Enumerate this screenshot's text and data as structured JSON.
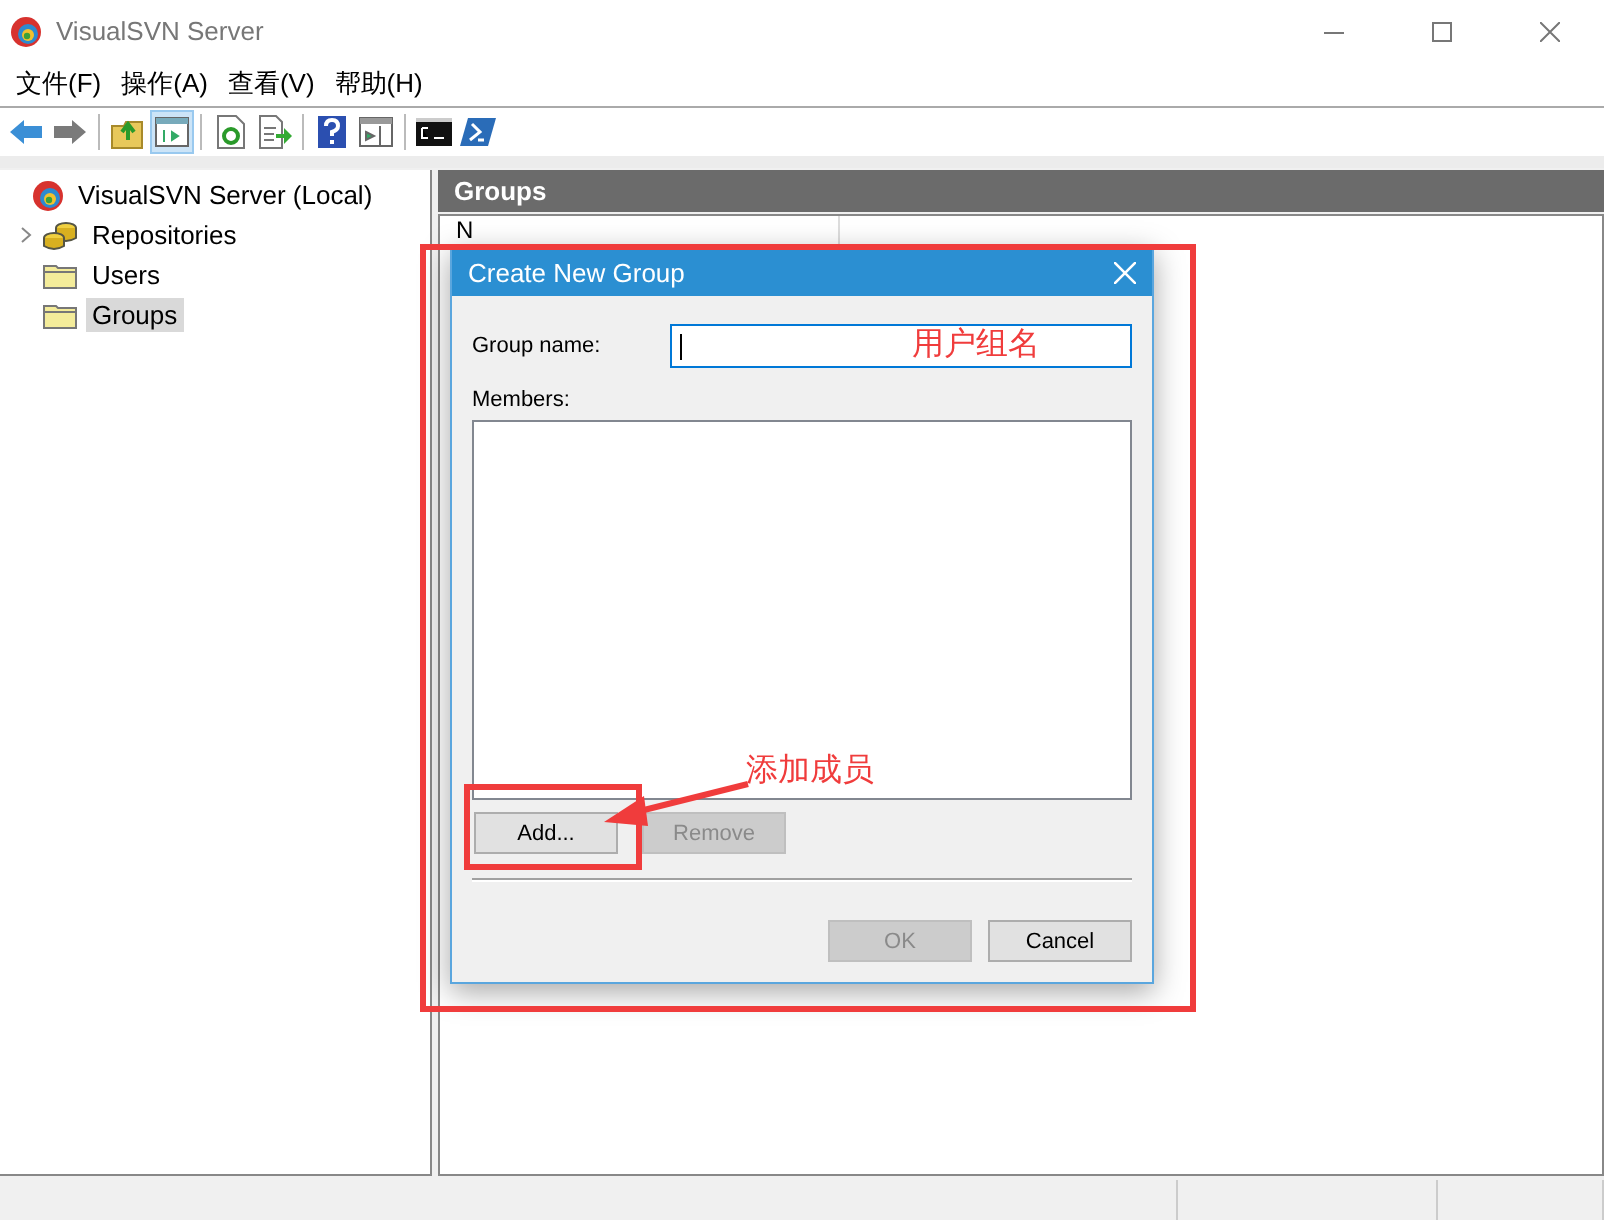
{
  "window": {
    "title": "VisualSVN Server"
  },
  "menu": [
    {
      "label": "文件(F)"
    },
    {
      "label": "操作(A)"
    },
    {
      "label": "查看(V)"
    },
    {
      "label": "帮助(H)"
    }
  ],
  "toolbar": [
    {
      "kind": "back",
      "selected": false
    },
    {
      "kind": "forward",
      "selected": false
    },
    {
      "kind": "separator"
    },
    {
      "kind": "up",
      "selected": false
    },
    {
      "kind": "tree",
      "selected": true
    },
    {
      "kind": "separator"
    },
    {
      "kind": "refresh",
      "selected": false
    },
    {
      "kind": "export",
      "selected": false
    },
    {
      "kind": "separator"
    },
    {
      "kind": "help",
      "selected": false
    },
    {
      "kind": "pane",
      "selected": false
    },
    {
      "kind": "separator"
    },
    {
      "kind": "cmd",
      "selected": false
    },
    {
      "kind": "shell",
      "selected": false
    }
  ],
  "tree": [
    {
      "label": "VisualSVN Server (Local)",
      "kind": "server",
      "selected": false,
      "children": [
        {
          "label": "Repositories",
          "kind": "repositories",
          "selected": false,
          "expanded": false
        },
        {
          "label": "Users",
          "kind": "folder",
          "selected": false
        },
        {
          "label": "Groups",
          "kind": "folder",
          "selected": true
        }
      ]
    }
  ],
  "pane": {
    "title": "Groups",
    "columns": [
      "N"
    ]
  },
  "dialog": {
    "title": "Create New Group",
    "group_name": {
      "label": "Group name:",
      "focused": true
    },
    "members": {
      "label": "Members:"
    },
    "list_buttons": [
      {
        "label": "Add...",
        "disabled": false
      },
      {
        "label": "Remove",
        "disabled": true
      }
    ],
    "buttons": [
      {
        "label": "OK",
        "disabled": true
      },
      {
        "label": "Cancel",
        "disabled": false
      }
    ]
  },
  "annotations": [
    {
      "kind": "dialog-frame"
    },
    {
      "kind": "button-frame"
    },
    {
      "kind": "note",
      "text": "用户组名"
    },
    {
      "kind": "arrow-note",
      "text": "添加成员"
    }
  ]
}
